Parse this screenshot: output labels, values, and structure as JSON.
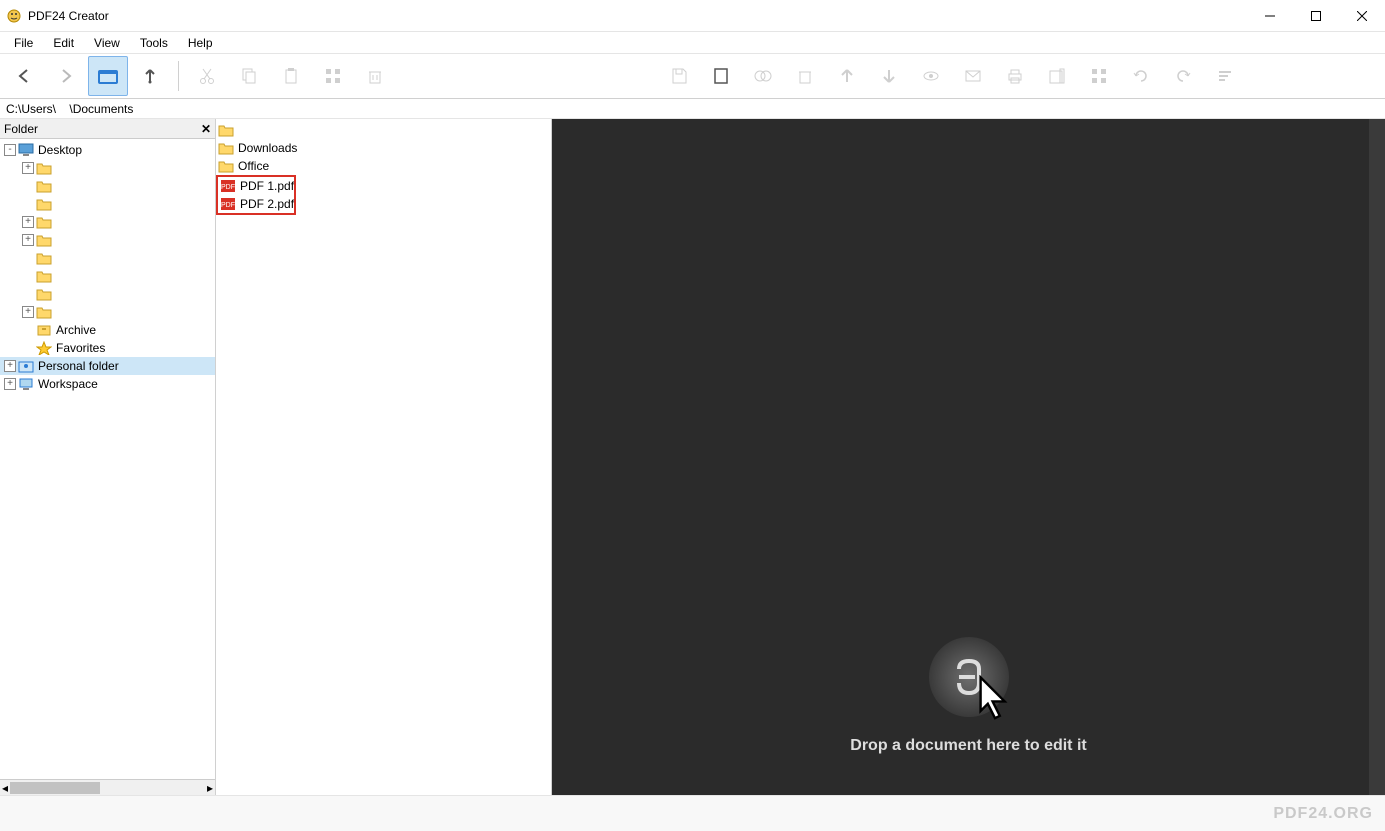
{
  "window": {
    "title": "PDF24 Creator"
  },
  "menu": {
    "items": [
      "File",
      "Edit",
      "View",
      "Tools",
      "Help"
    ]
  },
  "path": {
    "prefix": "C:\\Users\\",
    "suffix": "\\Documents"
  },
  "folder_panel": {
    "header": "Folder"
  },
  "tree": {
    "nodes": [
      {
        "label": "Desktop",
        "depth": 0,
        "expander": "-",
        "icon": "desktop"
      },
      {
        "label": "",
        "depth": 1,
        "expander": "+",
        "icon": "folder"
      },
      {
        "label": "",
        "depth": 1,
        "expander": "",
        "icon": "folder"
      },
      {
        "label": "",
        "depth": 1,
        "expander": "",
        "icon": "folder"
      },
      {
        "label": "",
        "depth": 1,
        "expander": "+",
        "icon": "folder"
      },
      {
        "label": "",
        "depth": 1,
        "expander": "+",
        "icon": "folder"
      },
      {
        "label": "",
        "depth": 1,
        "expander": "",
        "icon": "folder"
      },
      {
        "label": "",
        "depth": 1,
        "expander": "",
        "icon": "folder"
      },
      {
        "label": "",
        "depth": 1,
        "expander": "",
        "icon": "folder"
      },
      {
        "label": "",
        "depth": 1,
        "expander": "+",
        "icon": "folder"
      },
      {
        "label": "Archive",
        "depth": 1,
        "expander": "",
        "icon": "archive"
      },
      {
        "label": "Favorites",
        "depth": 1,
        "expander": "",
        "icon": "favorites"
      },
      {
        "label": "Personal folder",
        "depth": 0,
        "expander": "+",
        "icon": "personal",
        "selected": true
      },
      {
        "label": "Workspace",
        "depth": 0,
        "expander": "+",
        "icon": "workspace"
      }
    ]
  },
  "files": {
    "folders": [
      {
        "label": "",
        "icon": "folder"
      },
      {
        "label": "Downloads",
        "icon": "folder"
      },
      {
        "label": "Office",
        "icon": "folder"
      }
    ],
    "pdfs": [
      {
        "label": "PDF 1.pdf",
        "icon": "pdf"
      },
      {
        "label": "PDF 2.pdf",
        "icon": "pdf"
      }
    ]
  },
  "drop": {
    "text": "Drop a document here to edit it"
  },
  "footer": {
    "brand": "PDF24.ORG"
  }
}
